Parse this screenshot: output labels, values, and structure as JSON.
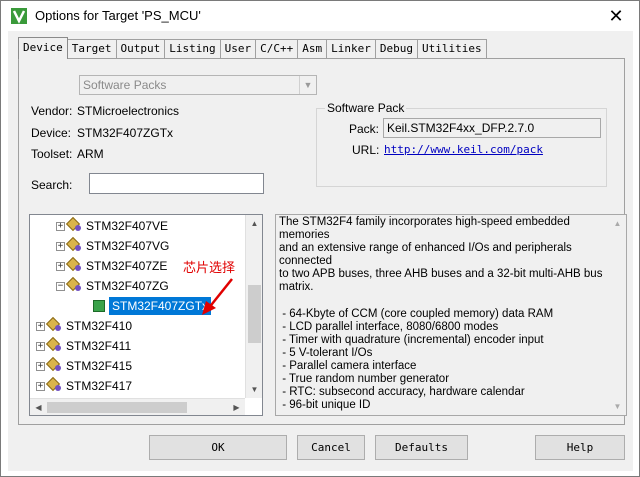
{
  "window": {
    "title": "Options for Target 'PS_MCU'",
    "close": "✕"
  },
  "tabs": [
    {
      "label": "Device",
      "active": true
    },
    {
      "label": "Target"
    },
    {
      "label": "Output"
    },
    {
      "label": "Listing"
    },
    {
      "label": "User"
    },
    {
      "label": "C/C++"
    },
    {
      "label": "Asm"
    },
    {
      "label": "Linker"
    },
    {
      "label": "Debug"
    },
    {
      "label": "Utilities"
    }
  ],
  "device": {
    "database_combo": "Software Packs",
    "vendor_label": "Vendor:",
    "vendor_value": "STMicroelectronics",
    "device_label": "Device:",
    "device_value": "STM32F407ZGTx",
    "toolset_label": "Toolset:",
    "toolset_value": "ARM",
    "search_label": "Search:",
    "search_value": ""
  },
  "software_pack": {
    "title": "Software Pack",
    "pack_label": "Pack:",
    "pack_value": "Keil.STM32F4xx_DFP.2.7.0",
    "url_label": "URL:",
    "url_value": "http://www.keil.com/pack"
  },
  "tree": {
    "items": [
      {
        "label": "STM32F407VE",
        "expander": "+"
      },
      {
        "label": "STM32F407VG",
        "expander": "+"
      },
      {
        "label": "STM32F407ZE",
        "expander": "+"
      },
      {
        "label": "STM32F407ZG",
        "expander": "−"
      },
      {
        "label": "STM32F407ZGTx",
        "selected": true
      },
      {
        "label": "STM32F410",
        "expander": "+"
      },
      {
        "label": "STM32F411",
        "expander": "+"
      },
      {
        "label": "STM32F415",
        "expander": "+"
      },
      {
        "label": "STM32F417",
        "expander": "+"
      }
    ]
  },
  "annotation": {
    "text": "芯片选择",
    "color": "#e00000"
  },
  "description": "The STM32F4 family incorporates high-speed embedded memories\nand an extensive range of enhanced I/Os and peripherals connected\nto two APB buses, three AHB buses and a 32-bit multi-AHB bus\nmatrix.\n\n - 64-Kbyte of CCM (core coupled memory) data RAM\n - LCD parallel interface, 8080/6800 modes\n - Timer with quadrature (incremental) encoder input\n - 5 V-tolerant I/Os\n - Parallel camera interface\n - True random number generator\n - RTC: subsecond accuracy, hardware calendar\n - 96-bit unique ID",
  "buttons": {
    "ok": "OK",
    "cancel": "Cancel",
    "defaults": "Defaults",
    "help": "Help"
  },
  "colors": {
    "selection": "#0078d7",
    "link": "#0000c0"
  }
}
